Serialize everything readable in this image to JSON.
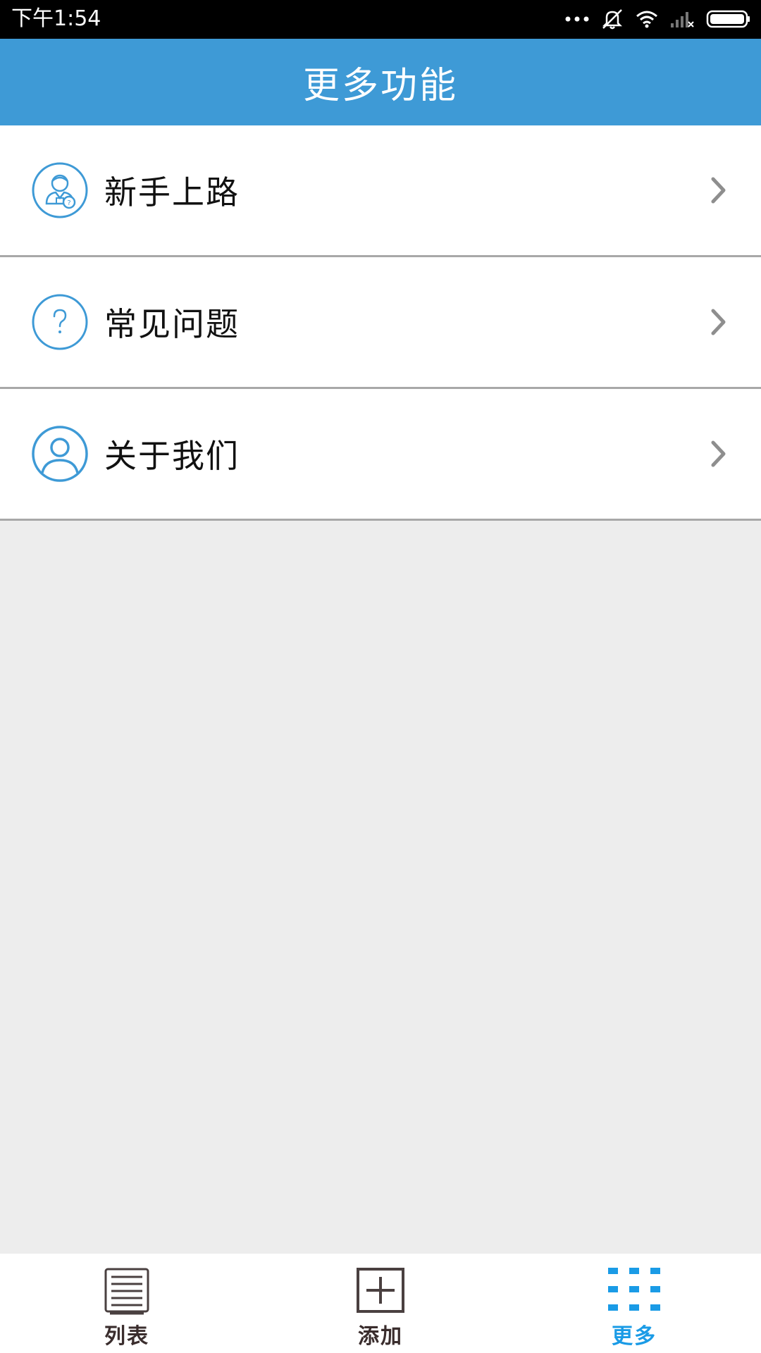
{
  "status_bar": {
    "time": "下午1:54",
    "icons": [
      "more-dots-icon",
      "mute-icon",
      "wifi-icon",
      "no-signal-icon",
      "battery-icon"
    ]
  },
  "header": {
    "title": "更多功能"
  },
  "menu": {
    "items": [
      {
        "label": "新手上路",
        "icon": "beginner-guide-icon"
      },
      {
        "label": "常见问题",
        "icon": "question-icon"
      },
      {
        "label": "关于我们",
        "icon": "user-icon"
      }
    ]
  },
  "bottom_nav": {
    "items": [
      {
        "label": "列表",
        "icon": "list-icon",
        "active": false
      },
      {
        "label": "添加",
        "icon": "add-icon",
        "active": false
      },
      {
        "label": "更多",
        "icon": "grid-icon",
        "active": true
      }
    ]
  },
  "colors": {
    "accent": "#3e9ad6",
    "nav_active": "#1a9be6",
    "nav_inactive": "#3a2d2d",
    "background": "#ededed"
  }
}
